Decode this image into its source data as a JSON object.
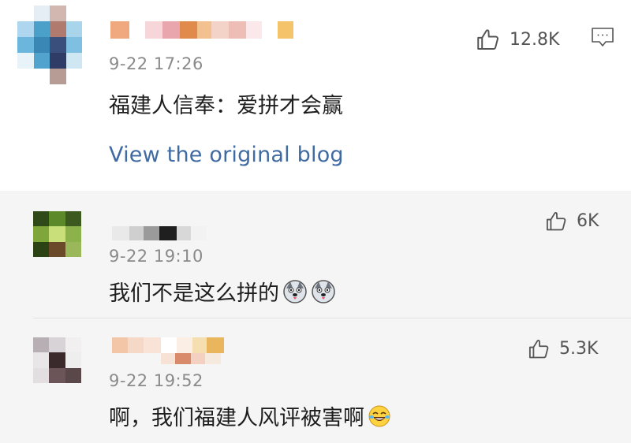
{
  "post": {
    "time": "9-22 17:26",
    "text": "福建人信奉：爱拼才会赢",
    "likes": "12.8K",
    "view_original_label": "View the original blog",
    "icons": [
      "thumbs-up-icon",
      "comment-icon"
    ]
  },
  "comments": [
    {
      "time": "9-22 19:10",
      "text": "我们不是这么拼的",
      "likes": "6K",
      "emoji": [
        "husky-doge-emoji",
        "husky-doge-emoji"
      ]
    },
    {
      "time": "9-22 19:52",
      "text": "啊，我们福建人风评被害啊",
      "likes": "5.3K",
      "emoji": [
        "laugh-cry-emoji"
      ]
    }
  ],
  "colors": {
    "link": "#3f6aa2",
    "time": "#8a8a8a",
    "text": "#1e1e1e",
    "comment_bg": "#f5f5f5"
  }
}
